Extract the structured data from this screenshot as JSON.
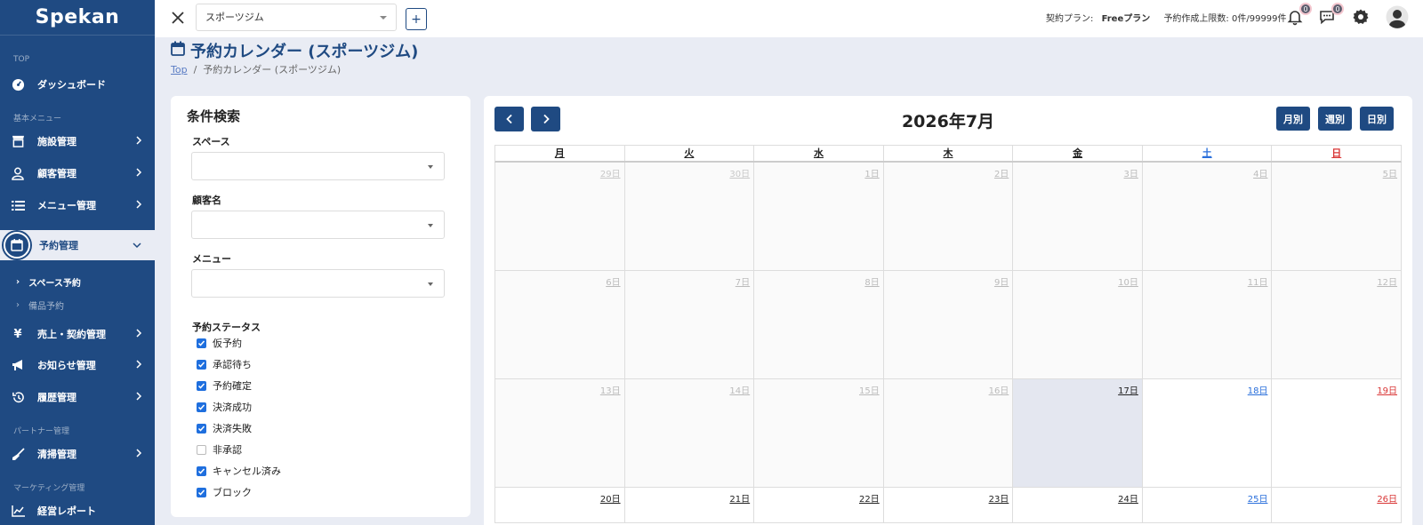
{
  "app": {
    "name": "Spekan"
  },
  "sidebar": {
    "sections": {
      "top": "TOP",
      "basic": "基本メニュー",
      "partner": "パートナー管理",
      "marketing": "マーケティング管理"
    },
    "items": {
      "dashboard": "ダッシュボード",
      "facility": "施設管理",
      "customer": "顧客管理",
      "menu": "メニュー管理",
      "reservation": "予約管理",
      "space_reservation": "スペース予約",
      "equipment_reservation": "備品予約",
      "sales": "売上・契約管理",
      "news": "お知らせ管理",
      "history": "履歴管理",
      "cleaning": "清掃管理",
      "report": "経営レポート"
    }
  },
  "topbar": {
    "facility_value": "スポーツジム",
    "add_label": "+",
    "plan_label": "契約プラン:",
    "plan_value": "Freeプラン",
    "limit_text": "予約作成上限数: 0件/99999件",
    "notifications_count": "0",
    "messages_count": "0"
  },
  "page": {
    "title": "予約カレンダー (スポーツジム)",
    "breadcrumb_top": "Top",
    "breadcrumb_sep": "/",
    "breadcrumb_current": "予約カレンダー (スポーツジム)"
  },
  "filter": {
    "title": "条件検索",
    "space_label": "スペース",
    "customer_label": "顧客名",
    "menu_label": "メニュー",
    "status_label": "予約ステータス",
    "statuses": [
      {
        "label": "仮予約",
        "checked": true
      },
      {
        "label": "承認待ち",
        "checked": true
      },
      {
        "label": "予約確定",
        "checked": true
      },
      {
        "label": "決済成功",
        "checked": true
      },
      {
        "label": "決済失敗",
        "checked": true
      },
      {
        "label": "非承認",
        "checked": false
      },
      {
        "label": "キャンセル済み",
        "checked": true
      },
      {
        "label": "ブロック",
        "checked": true
      }
    ]
  },
  "calendar": {
    "month_title": "2026年7月",
    "views": {
      "month": "月別",
      "week": "週別",
      "day": "日別"
    },
    "weekdays": [
      "月",
      "火",
      "水",
      "木",
      "金",
      "土",
      "日"
    ],
    "weeks": [
      [
        "29日",
        "30日",
        "1日",
        "2日",
        "3日",
        "4日",
        "5日"
      ],
      [
        "6日",
        "7日",
        "8日",
        "9日",
        "10日",
        "11日",
        "12日"
      ],
      [
        "13日",
        "14日",
        "15日",
        "16日",
        "17日",
        "18日",
        "19日"
      ],
      [
        "20日",
        "21日",
        "22日",
        "23日",
        "24日",
        "25日",
        "26日"
      ]
    ],
    "colors": {
      "saturday": "#2a6fdb",
      "sunday": "#d93636",
      "accent": "#1f4a82"
    }
  }
}
